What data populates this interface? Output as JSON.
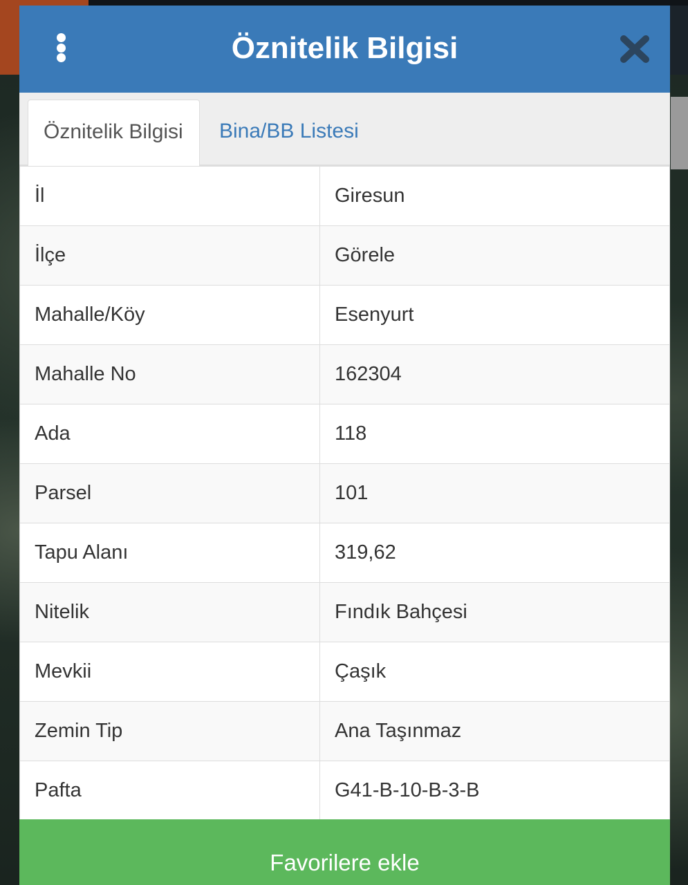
{
  "dialog": {
    "title": "Öznitelik Bilgisi",
    "accent_color": "#3a7ab8",
    "close_icon": "close-icon",
    "menu_icon": "vertical-dots-icon"
  },
  "tabs": [
    {
      "label": "Öznitelik Bilgisi",
      "active": true
    },
    {
      "label": "Bina/BB Listesi",
      "active": false
    }
  ],
  "attributes": [
    {
      "key": "İl",
      "value": "Giresun"
    },
    {
      "key": "İlçe",
      "value": "Görele"
    },
    {
      "key": "Mahalle/Köy",
      "value": "Esenyurt"
    },
    {
      "key": "Mahalle No",
      "value": "162304"
    },
    {
      "key": "Ada",
      "value": "118"
    },
    {
      "key": "Parsel",
      "value": "101"
    },
    {
      "key": "Tapu Alanı",
      "value": "319,62"
    },
    {
      "key": "Nitelik",
      "value": "Fındık Bahçesi"
    },
    {
      "key": "Mevkii",
      "value": "Çaşık"
    },
    {
      "key": "Zemin Tip",
      "value": "Ana Taşınmaz"
    },
    {
      "key": "Pafta",
      "value": "G41-B-10-B-3-B"
    }
  ],
  "footer": {
    "favorite_label": "Favorilere ekle",
    "button_color": "#5cb85c"
  }
}
